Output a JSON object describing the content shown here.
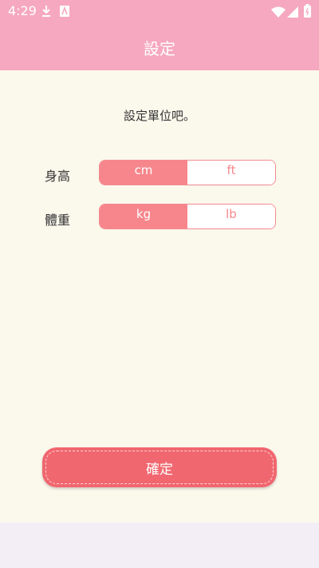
{
  "status_bar": {
    "time": "4:29",
    "icons": [
      "download-icon",
      "sim-icon",
      "wifi-icon",
      "signal-icon",
      "battery-icon"
    ]
  },
  "app_bar": {
    "title": "設定"
  },
  "prompt": "設定單位吧。",
  "settings": {
    "height": {
      "label": "身高",
      "options": [
        "cm",
        "ft"
      ],
      "selected": "cm"
    },
    "weight": {
      "label": "體重",
      "options": [
        "kg",
        "lb"
      ],
      "selected": "kg"
    }
  },
  "confirm_label": "確定",
  "colors": {
    "header": "#f6a8c0",
    "background": "#fbf8ec",
    "accent": "#f7868c",
    "button": "#f1676f"
  }
}
